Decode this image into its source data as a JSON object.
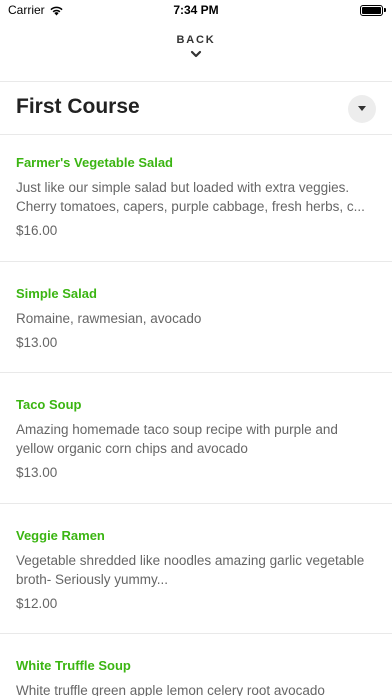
{
  "status_bar": {
    "carrier": "Carrier",
    "time": "7:34 PM"
  },
  "nav": {
    "back_label": "BACK"
  },
  "section": {
    "title": "First Course"
  },
  "colors": {
    "accent": "#3bb512",
    "divider": "#e9e9e9",
    "text_muted": "#666666"
  },
  "items": [
    {
      "name": "Farmer's Vegetable Salad",
      "desc1": "Just like our simple salad but loaded with extra veggies.",
      "desc2": "Cherry tomatoes, capers, purple cabbage, fresh herbs, c...",
      "price": "$16.00"
    },
    {
      "name": "Simple Salad",
      "desc1": "Romaine, rawmesian, avocado",
      "price": "$13.00"
    },
    {
      "name": "Taco Soup",
      "desc1": "Amazing homemade taco soup recipe with purple and",
      "desc2": "yellow organic corn chips and avocado",
      "price": "$13.00"
    },
    {
      "name": "Veggie Ramen",
      "desc1": "Vegetable shredded like noodles amazing garlic vegetable",
      "desc2": "broth- Seriously yummy...",
      "price": "$12.00"
    },
    {
      "name": "White Truffle Soup",
      "desc1": "White truffle green apple lemon celery root avocado"
    }
  ]
}
